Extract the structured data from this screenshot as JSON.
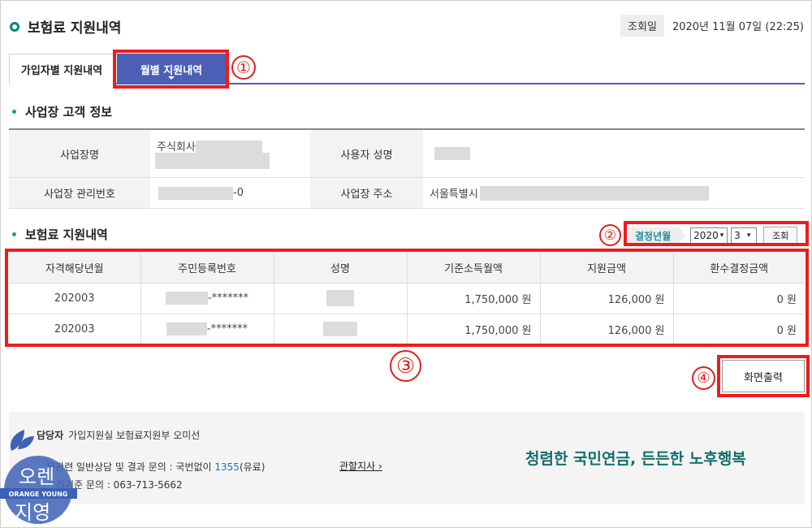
{
  "header": {
    "title": "보험료 지원내역",
    "lookup_label": "조회일",
    "lookup_date": "2020년 11월 07일 (22:25)"
  },
  "tabs": [
    {
      "label": "가입자별 지원내역"
    },
    {
      "label": "월별 지원내역"
    }
  ],
  "callouts": [
    "①",
    "②",
    "③",
    "④"
  ],
  "customer_section": {
    "title": "사업장 고객 정보",
    "labels": {
      "business_name": "사업장명",
      "user_name": "사용자 성명",
      "business_number": "사업장 관리번호",
      "business_address": "사업장 주소"
    },
    "values": {
      "business_name_prefix": "주식회사",
      "business_number_suffix": "-0",
      "business_address_prefix": "서울특별시"
    }
  },
  "support_section": {
    "title": "보험료 지원내역",
    "filter": {
      "label": "결정년월",
      "year": "2020",
      "month": "3",
      "button": "조회"
    },
    "columns": [
      "자격해당년월",
      "주민등록번호",
      "성명",
      "기준소득월액",
      "지원금액",
      "환수결정금액"
    ],
    "rows": [
      {
        "month": "202003",
        "id_suffix": "-*******",
        "income": "1,750,000 원",
        "support": "126,000 원",
        "refund": "0 원"
      },
      {
        "month": "202003",
        "id_suffix": "-*******",
        "income": "1,750,000 원",
        "support": "126,000 원",
        "refund": "0 원"
      }
    ],
    "print_button": "화면출력"
  },
  "footer": {
    "contact_label": "담당자",
    "contact_value": "가입지원실 보험료지원부 오미선",
    "line2_prefix": "문관련 일반상담 및 결과 문의 : 국번없이 ",
    "line2_number": "1355",
    "line2_suffix": "(유료)",
    "line3": "리기준 문의 : 063-713-5662",
    "branch_link": "관할지사 ›",
    "slogan": "청렴한 국민연금, 든든한 노후행복"
  },
  "watermark": {
    "text_top": "오렌",
    "text_band": "ORANGE YOUNG",
    "text_bottom": "지영"
  },
  "colors": {
    "accent_tab": "#4b5fb7",
    "highlight_red": "#ee1b1b",
    "teal": "#1a9e8e",
    "slogan": "#156f6c"
  }
}
